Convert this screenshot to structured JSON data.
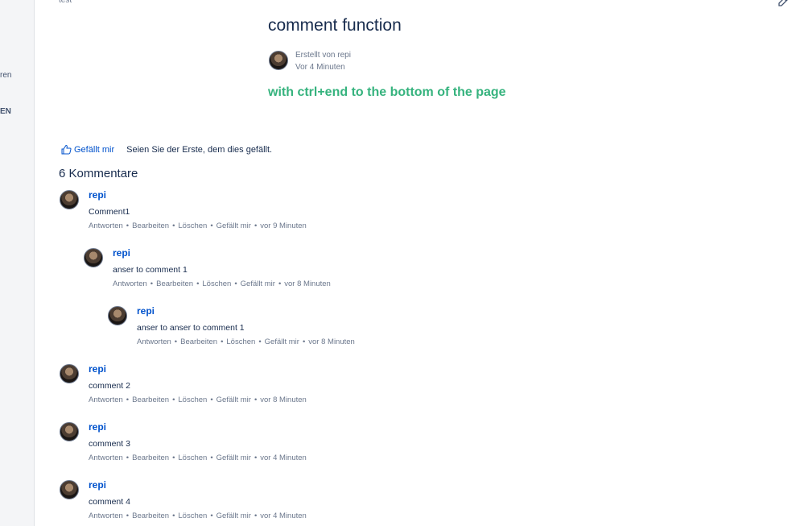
{
  "sidebar": {
    "items": [
      {
        "label": "ren"
      },
      {
        "label": "EN"
      }
    ]
  },
  "breadcrumb": {
    "label": "test"
  },
  "page": {
    "title": "comment function",
    "created_by": "Erstellt von repi",
    "created_time": "Vor 4 Minuten",
    "headline": "with ctrl+end to the bottom of the page",
    "headline_color": "#36b37e"
  },
  "likes": {
    "button_label": "Gefällt mir",
    "text": "Seien Sie der Erste, dem dies gefällt."
  },
  "comments_heading": "6 Kommentare",
  "actions": {
    "reply": "Antworten",
    "edit": "Bearbeiten",
    "delete": "Löschen",
    "like": "Gefällt mir",
    "separator": "•"
  },
  "comments": [
    {
      "author": "repi",
      "body": "Comment1",
      "time": "vor 9 Minuten"
    },
    {
      "author": "repi",
      "body": "anser to comment 1",
      "time": "vor 8 Minuten"
    },
    {
      "author": "repi",
      "body": "anser to anser to comment 1",
      "time": "vor 8 Minuten"
    },
    {
      "author": "repi",
      "body": "comment 2",
      "time": "vor 8 Minuten"
    },
    {
      "author": "repi",
      "body": "comment 3",
      "time": "vor 4 Minuten"
    },
    {
      "author": "repi",
      "body": "comment 4",
      "time": "vor 4 Minuten"
    }
  ],
  "icons": {
    "edit": "pencil-icon",
    "more": "more-icon",
    "like": "thumbs-up-icon"
  },
  "colors": {
    "link": "#0052cc",
    "text": "#172b4d",
    "muted": "#6b778c",
    "sidebar_bg": "#f4f5f7"
  }
}
